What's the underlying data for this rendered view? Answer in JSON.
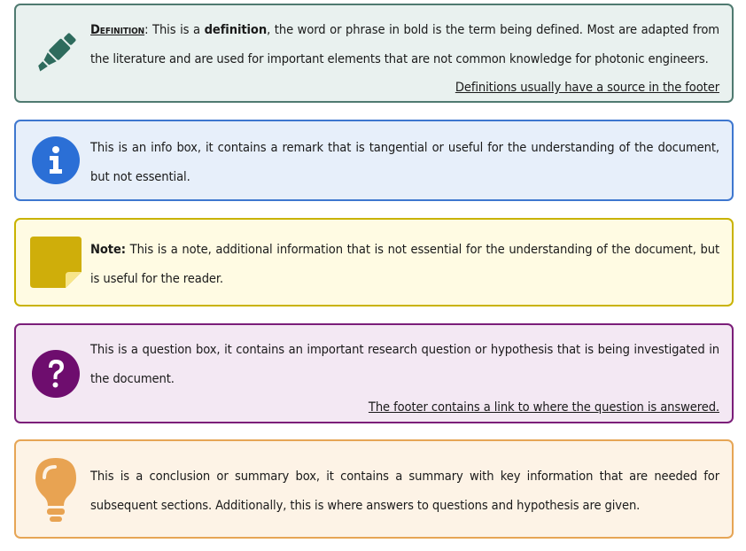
{
  "definition": {
    "icon": "highlighter-icon",
    "term_label": "Definition",
    "colon": ":",
    "text_before": " This is a ",
    "bold_word": "definition",
    "text_after": ", the word or phrase in bold is the term being defined. Most are adapted from the literature and are used for important elements that are not common knowledge for photonic engineers.",
    "footer_link": "Definitions usually have a source in the footer",
    "colors": {
      "border": "#4f7a70",
      "background": "#e9f1ef",
      "icon": "#2e6b5d"
    }
  },
  "info": {
    "icon": "info-icon",
    "text": "This is an info box, it contains a remark that is tangential or useful for the understanding of the document, but not essential.",
    "colors": {
      "border": "#3e77cf",
      "background": "#e7effa",
      "icon": "#2b6fd6"
    }
  },
  "note": {
    "icon": "sticky-note-icon",
    "label": "Note:",
    "text": " This is a note, additional information that is not essential for the understanding of the document, but is useful for the reader.",
    "colors": {
      "border": "#c9b300",
      "background": "#fffbe3",
      "icon": "#cfae0a"
    }
  },
  "question": {
    "icon": "question-icon",
    "text": "This is a question box, it contains an important research question or hypothesis that is being investigated in the document.",
    "footer_link": "The footer contains a link to where the question is answered.",
    "colors": {
      "border": "#7b1e79",
      "background": "#f3e8f3",
      "icon": "#6e0d6e"
    }
  },
  "conclusion": {
    "icon": "lightbulb-icon",
    "text": "This is a conclusion or summary box, it contains a summary with key information that are needed for subsequent sections. Additionally, this is where answers to questions and hypothesis are given.",
    "colors": {
      "border": "#e6a555",
      "background": "#fdf3e6",
      "icon": "#e8a352"
    }
  }
}
